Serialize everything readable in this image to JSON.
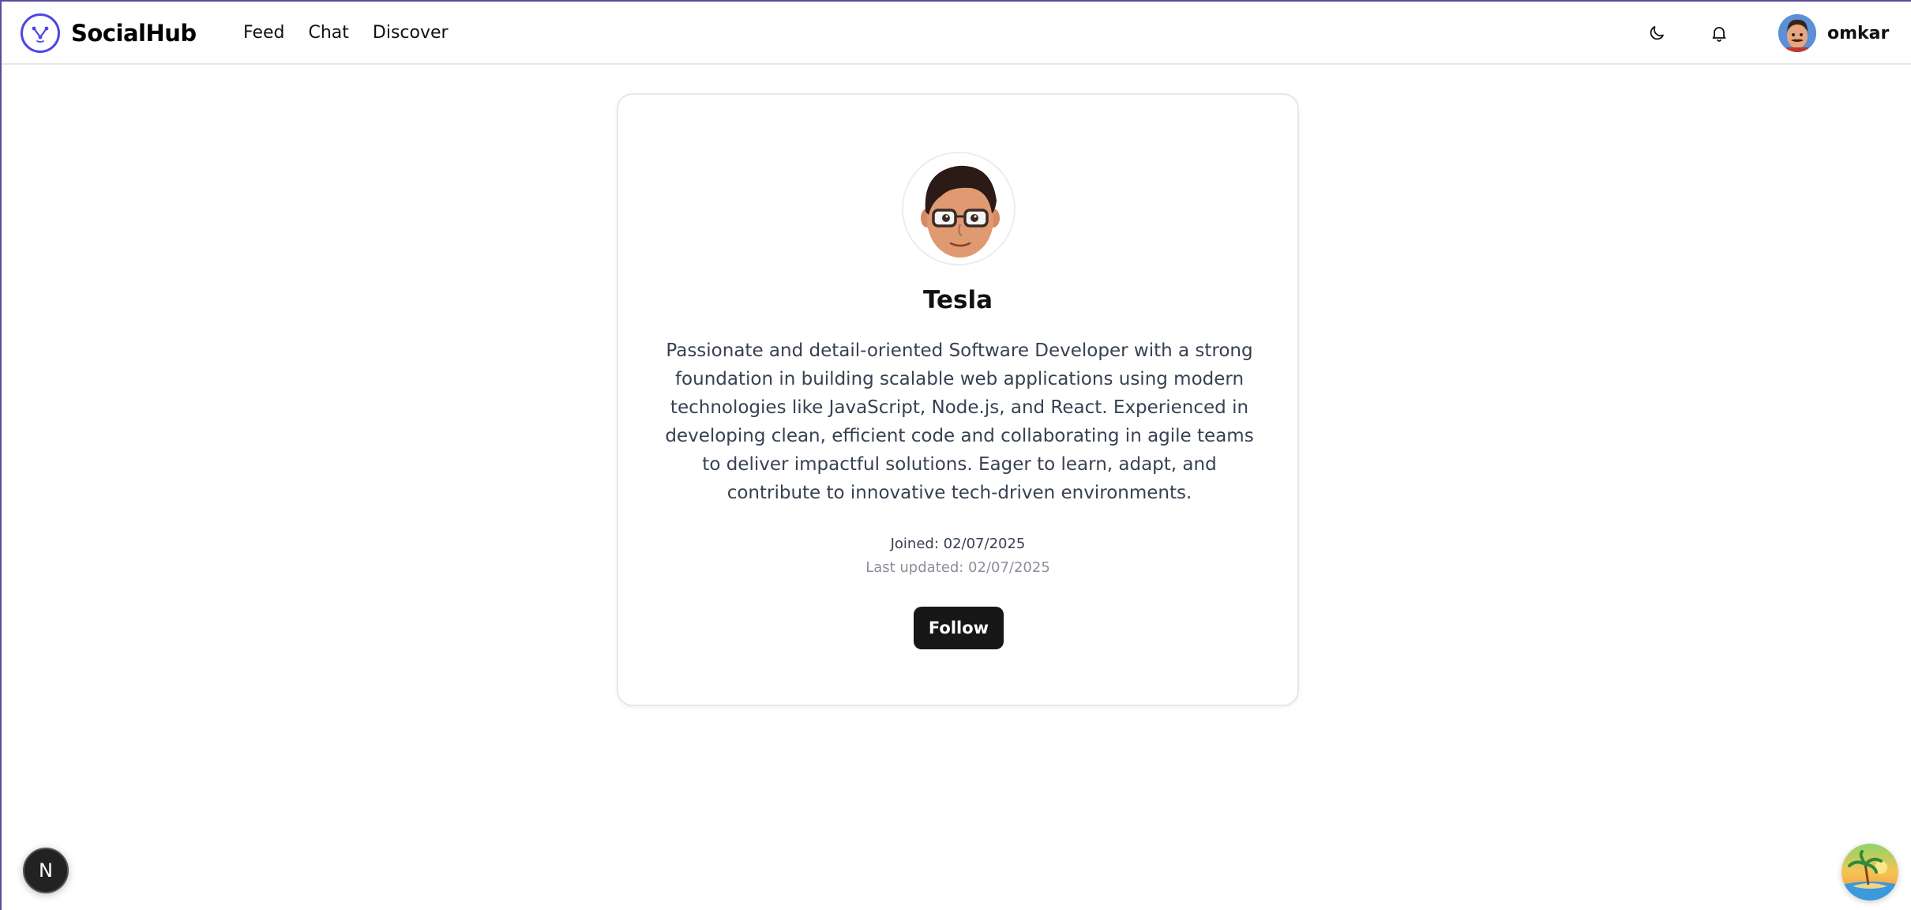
{
  "app": {
    "brand_name": "SocialHub"
  },
  "nav": {
    "links": [
      "Feed",
      "Chat",
      "Discover"
    ]
  },
  "header": {
    "user_name": "omkar",
    "theme_icon": "moon-icon",
    "notifications_icon": "bell-icon"
  },
  "profile": {
    "name": "Tesla",
    "bio": "Passionate and detail-oriented Software Developer with a strong foundation in building scalable web applications using modern technologies like JavaScript, Node.js, and React. Experienced in developing clean, efficient code and collaborating in agile teams to deliver impactful solutions. Eager to learn, adapt, and contribute to innovative tech-driven environments.",
    "joined": "Joined: 02/07/2025",
    "last_updated": "Last updated: 02/07/2025",
    "follow_label": "Follow"
  },
  "floating": {
    "next_badge_label": "N"
  },
  "colors": {
    "accent": "#4f46e5",
    "button_bg": "#171717",
    "text_muted": "#8a8f98"
  }
}
